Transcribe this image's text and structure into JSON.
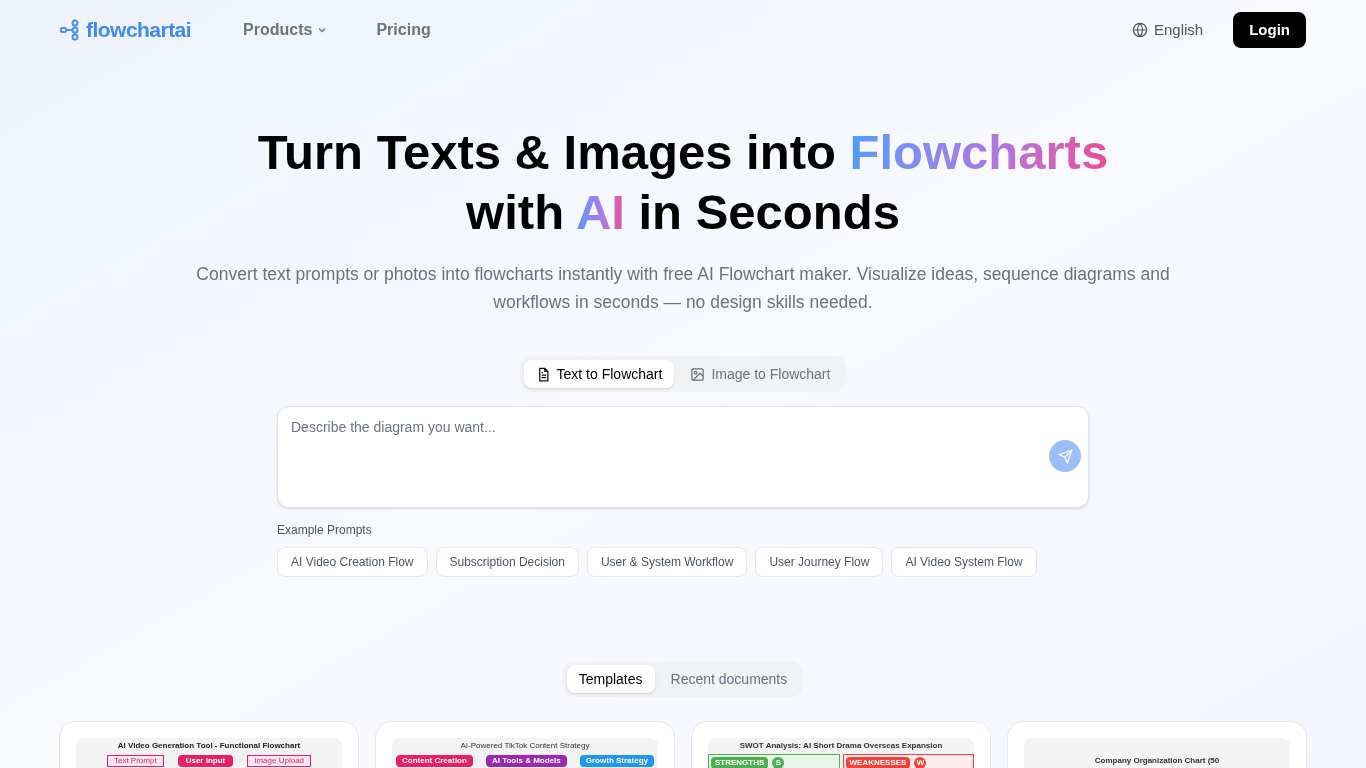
{
  "nav": {
    "logo": "flowchartai",
    "links": [
      {
        "label": "Products",
        "dropdown": true
      },
      {
        "label": "Pricing",
        "dropdown": false
      }
    ],
    "language": "English",
    "login": "Login"
  },
  "hero": {
    "title_lines": [
      [
        {
          "text": "Turn Texts & Images into ",
          "highlight": false
        },
        {
          "text": "Flowcharts",
          "highlight": true
        }
      ],
      [
        {
          "text": "with ",
          "highlight": false
        },
        {
          "text": "AI",
          "highlight": true
        },
        {
          "text": " in Seconds",
          "highlight": false
        }
      ]
    ],
    "subtitle": "Convert text prompts or photos into flowcharts instantly with free AI Flowchart maker. Visualize ideas, sequence diagrams and workflows in seconds — no design skills needed."
  },
  "mode_tabs": [
    {
      "label": "Text to Flowchart",
      "kind": "text",
      "selected": true
    },
    {
      "label": "Image to Flowchart",
      "kind": "image",
      "selected": false
    }
  ],
  "prompt": {
    "placeholder": "Describe the diagram you want..."
  },
  "examples": {
    "label": "Example Prompts",
    "items": [
      "AI Video Creation Flow",
      "Subscription Decision",
      "User & System Workflow",
      "User Journey Flow",
      "AI Video System Flow"
    ]
  },
  "doc_tabs": [
    {
      "label": "Templates",
      "selected": true
    },
    {
      "label": "Recent documents",
      "selected": false
    }
  ],
  "templates": [
    {
      "kind": "flow",
      "title": "AI Video Generation Tool - Functional Flowchart",
      "nodes": [
        "Text Prompt",
        "User Input",
        "Image Upload"
      ]
    },
    {
      "kind": "mindmap",
      "title": "AI-Powered TikTok Content Strategy",
      "nodes": [
        "Content Creation",
        "AI Tools & Models",
        "Growth Strategy"
      ]
    },
    {
      "kind": "swot",
      "title": "SWOT Analysis: AI Short Drama Overseas Expansion",
      "nodes": [
        "STRENGTHS",
        "S",
        "WEAKNESSES",
        "W"
      ]
    },
    {
      "kind": "org",
      "title": "Company Organization Chart (50"
    }
  ]
}
